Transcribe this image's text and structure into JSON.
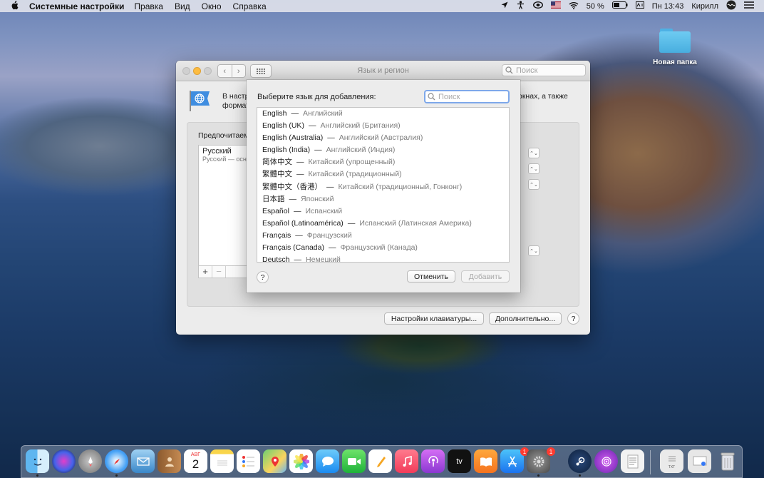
{
  "menubar": {
    "app": "Системные настройки",
    "items": [
      "Правка",
      "Вид",
      "Окно",
      "Справка"
    ],
    "battery": "50 %",
    "clock": "Пн 13:43",
    "user": "Кирилл"
  },
  "desktop": {
    "folder_label": "Новая папка"
  },
  "window": {
    "title": "Язык и регион",
    "search_placeholder": "Поиск",
    "intro_left": "В настр",
    "intro_left2": "формат",
    "intro_right": "окнах, а также",
    "preferred_label": "Предпочитаем",
    "languages": [
      {
        "name": "Русский",
        "sub": "Русский — осно"
      }
    ],
    "keyboard_button": "Настройки клавиатуры...",
    "advanced_button": "Дополнительно...",
    "help": "?"
  },
  "sheet": {
    "prompt": "Выберите язык для добавления:",
    "search_placeholder": "Поиск",
    "dash": "—",
    "languages": [
      {
        "name": "English",
        "translation": "Английский"
      },
      {
        "name": "English (UK)",
        "translation": "Английский (Британия)"
      },
      {
        "name": "English (Australia)",
        "translation": "Английский (Австралия)"
      },
      {
        "name": "English (India)",
        "translation": "Английский (Индия)"
      },
      {
        "name": "简体中文",
        "translation": "Китайский (упрощенный)"
      },
      {
        "name": "繁體中文",
        "translation": "Китайский (традиционный)"
      },
      {
        "name": "繁體中文（香港）",
        "translation": "Китайский (традиционный, Гонконг)"
      },
      {
        "name": "日本語",
        "translation": "Японский"
      },
      {
        "name": "Español",
        "translation": "Испанский"
      },
      {
        "name": "Español (Latinoamérica)",
        "translation": "Испанский (Латинская Америка)"
      },
      {
        "name": "Français",
        "translation": "Французский"
      },
      {
        "name": "Français (Canada)",
        "translation": "Французский (Канада)"
      },
      {
        "name": "Deutsch",
        "translation": "Немецкий"
      }
    ],
    "cancel_button": "Отменить",
    "add_button": "Добавить",
    "help": "?"
  },
  "dock": {
    "calendar_month": "АВГ",
    "calendar_day": "2",
    "appletv_label": "tv",
    "appstore_badge": "1",
    "sysprefs_badge": "1",
    "textedit_label": "TXT"
  }
}
